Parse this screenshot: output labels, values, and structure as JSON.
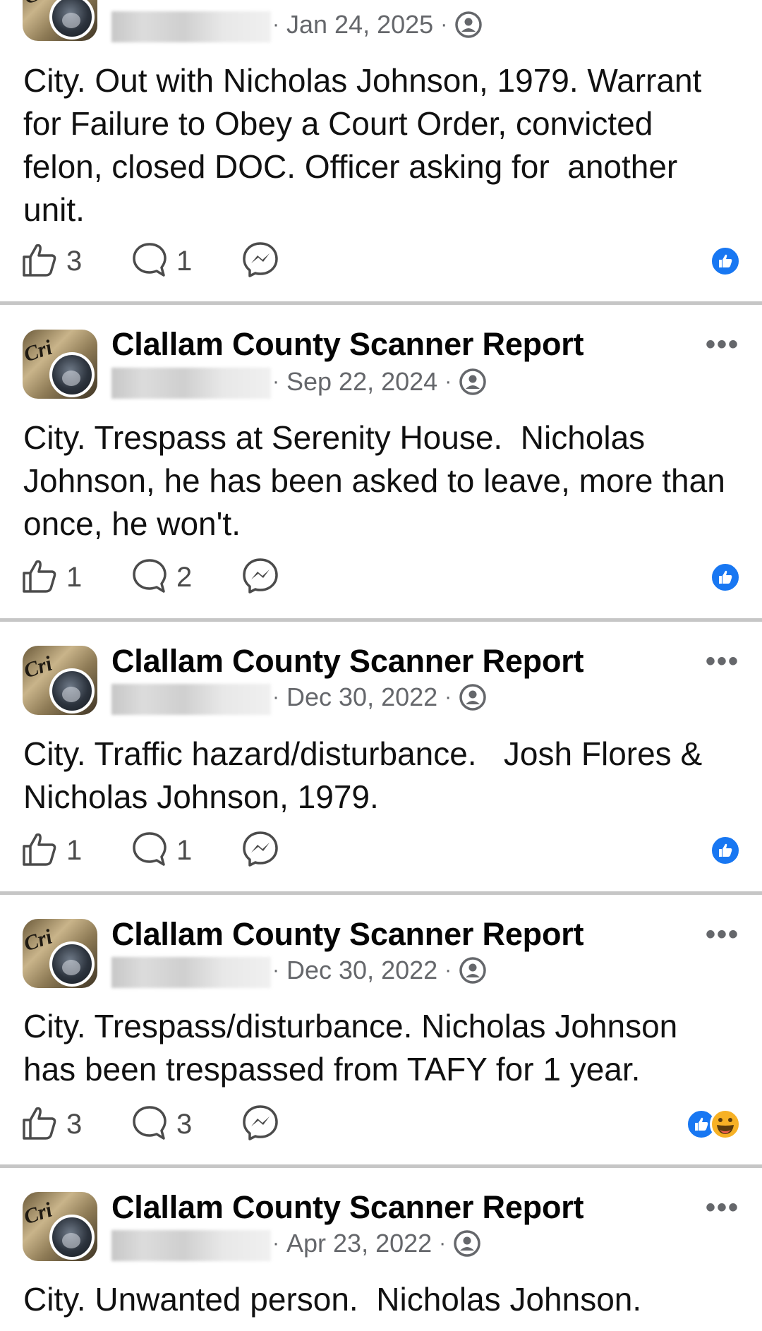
{
  "feed": {
    "posts": [
      {
        "page_name": "",
        "date": "Jan 24, 2025",
        "text": "City. Out with Nicholas Johnson, 1979. Warrant\nfor Failure to Obey a Court Order, convicted\nfelon, closed DOC. Officer asking for  another\nunit.",
        "likes": "3",
        "comments": "1",
        "reactions": [
          "like"
        ]
      },
      {
        "page_name": "Clallam County Scanner Report",
        "date": "Sep 22, 2024",
        "text": "City. Trespass at Serenity House.  Nicholas\nJohnson, he has been asked to leave, more than\nonce, he won't.",
        "likes": "1",
        "comments": "2",
        "reactions": [
          "like"
        ]
      },
      {
        "page_name": "Clallam County Scanner Report",
        "date": "Dec 30, 2022",
        "text": "City. Traffic hazard/disturbance.   Josh Flores &\nNicholas Johnson, 1979.",
        "likes": "1",
        "comments": "1",
        "reactions": [
          "like"
        ]
      },
      {
        "page_name": "Clallam County Scanner Report",
        "date": "Dec 30, 2022",
        "text": "City. Trespass/disturbance. Nicholas Johnson\nhas been trespassed from TAFY for 1 year.",
        "likes": "3",
        "comments": "3",
        "reactions": [
          "like",
          "haha"
        ]
      },
      {
        "page_name": "Clallam County Scanner Report",
        "date": "Apr 23, 2022",
        "text": "City. Unwanted person.  Nicholas Johnson.",
        "likes": "",
        "comments": "",
        "reactions": []
      }
    ],
    "avatar_text": "Cri",
    "more_glyph": "•••",
    "date_separator": "·",
    "colors": {
      "brand_blue": "#1877f2",
      "meta_gray": "#65676b",
      "separator": "#c6c6c6"
    },
    "icons": {
      "like": "thumbs-up-outline-icon",
      "comment": "speech-bubble-icon",
      "share": "messenger-icon",
      "audience": "friends-audience-icon",
      "reaction_like": "like-reaction-icon",
      "reaction_haha": "haha-reaction-icon"
    }
  }
}
